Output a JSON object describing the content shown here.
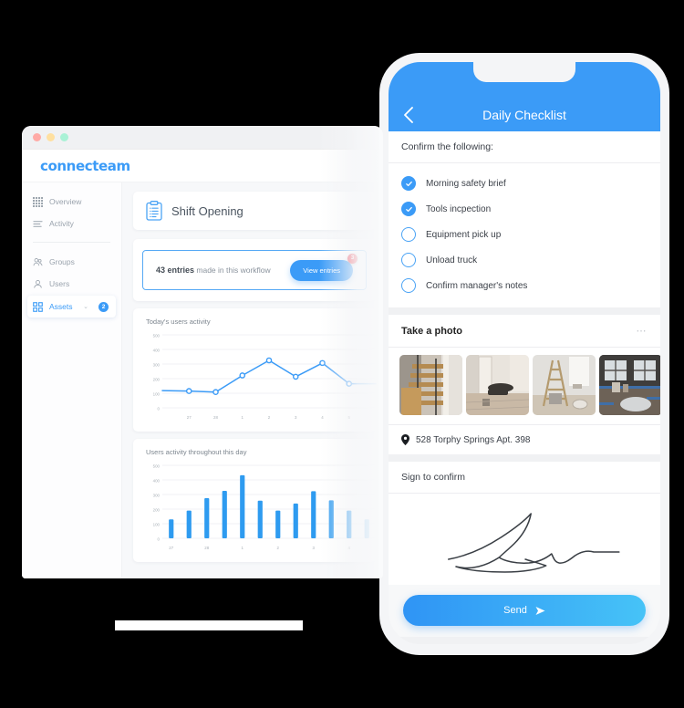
{
  "desktop": {
    "window_controls": [
      "close",
      "minimize",
      "maximize"
    ],
    "logo": "connecteam",
    "sidebar": {
      "items": [
        {
          "label": "Overview",
          "icon": "grid-icon",
          "active": false
        },
        {
          "label": "Activity",
          "icon": "list-icon",
          "active": false
        },
        {
          "label": "Groups",
          "icon": "groups-icon",
          "active": false
        },
        {
          "label": "Users",
          "icon": "user-icon",
          "active": false
        },
        {
          "label": "Assets",
          "icon": "assets-icon",
          "active": true,
          "badge": "2",
          "chevron": "⌄"
        }
      ]
    },
    "header": {
      "title": "Shift Opening",
      "icon": "clipboard-icon"
    },
    "entries": {
      "count_label": "43 entries",
      "suffix_label": " made in this workflow",
      "button_label": "View entries",
      "badge": "3"
    },
    "chart_data": [
      {
        "type": "line",
        "title": "Today's users activity",
        "categories": [
          "",
          "27",
          "28",
          "1",
          "2",
          "3",
          "4",
          "5",
          ""
        ],
        "values": [
          118,
          115,
          108,
          222,
          325,
          213,
          307,
          165,
          165
        ],
        "xlabel": "",
        "ylabel": "",
        "ylim": [
          0,
          500
        ],
        "yticks": [
          0,
          100,
          200,
          300,
          400,
          500
        ],
        "grid": true,
        "color": "#3b9bf7"
      },
      {
        "type": "bar",
        "title": "Users activity throughout this day",
        "categories": [
          "27",
          "",
          "28",
          "",
          "1",
          "",
          "2",
          "",
          "3",
          "",
          "4",
          "",
          "5",
          ""
        ],
        "values": [
          130,
          190,
          275,
          325,
          432,
          258,
          190,
          238,
          323,
          260,
          190,
          130
        ],
        "xlabel": "",
        "ylabel": "",
        "ylim": [
          0,
          500
        ],
        "yticks": [
          0,
          100,
          200,
          300,
          400,
          500
        ],
        "xticks": [
          "27",
          "28",
          "1",
          "2",
          "3",
          "4",
          "5"
        ],
        "grid": true,
        "color": "#2e9bf0"
      }
    ]
  },
  "phone": {
    "topbar": {
      "title": "Daily Checklist",
      "back_icon": "chevron-left-icon"
    },
    "checklist": {
      "heading": "Confirm the following:",
      "items": [
        {
          "label": "Morning safety brief",
          "checked": true
        },
        {
          "label": "Tools incpection",
          "checked": true
        },
        {
          "label": "Equipment pick up",
          "checked": false
        },
        {
          "label": "Unload truck",
          "checked": false
        },
        {
          "label": "Confirm manager's notes",
          "checked": false
        }
      ]
    },
    "photos": {
      "heading": "Take a photo",
      "menu_icon": "more-dots-icon",
      "items": [
        {
          "alt": "wooden-staircase-construction"
        },
        {
          "alt": "hallway-with-tools"
        },
        {
          "alt": "ladder-in-room"
        },
        {
          "alt": "room-with-plastic-sheeting"
        }
      ]
    },
    "location": {
      "icon": "map-pin-icon",
      "address": "528 Torphy Springs Apt. 398"
    },
    "signature": {
      "heading": "Sign to confirm",
      "has_signature": true
    },
    "send": {
      "label": "Send",
      "icon": "send-arrow-icon"
    }
  },
  "theme": {
    "accent": "#3b9bf7",
    "accent_light": "#46c3f7",
    "danger": "#ef4b5c",
    "background": "#000000",
    "surface": "#ffffff",
    "muted_text": "#9aa3ad"
  }
}
